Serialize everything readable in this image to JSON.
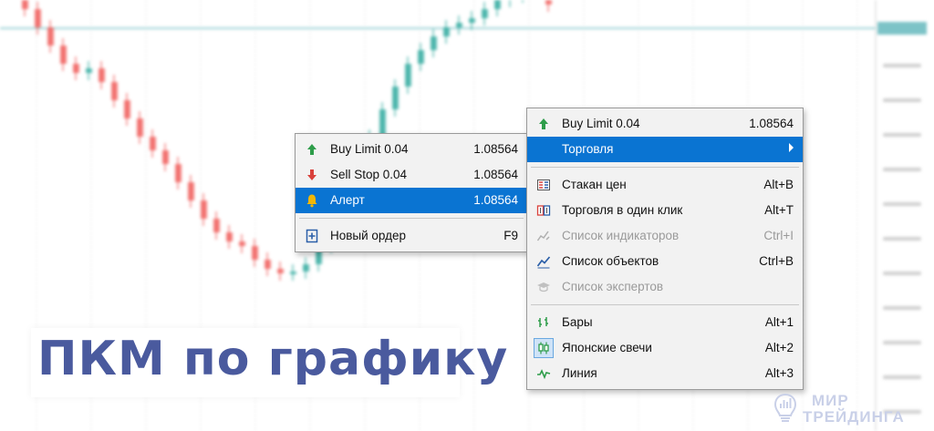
{
  "context_menu": {
    "items": [
      {
        "label": "Buy Limit 0.04",
        "right": "1.08564",
        "icon": "buy-limit-icon"
      },
      {
        "label": "Торговля",
        "right": "",
        "icon": "",
        "highlighted": true,
        "has_submenu": true
      },
      {
        "label": "Стакан цен",
        "right": "Alt+B",
        "icon": "depth-of-market-icon"
      },
      {
        "label": "Торговля в один клик",
        "right": "Alt+T",
        "icon": "one-click-trading-icon"
      },
      {
        "label": "Список индикаторов",
        "right": "Ctrl+I",
        "icon": "indicators-list-icon",
        "disabled": true
      },
      {
        "label": "Список объектов",
        "right": "Ctrl+B",
        "icon": "objects-list-icon"
      },
      {
        "label": "Список экспертов",
        "right": "",
        "icon": "experts-list-icon",
        "disabled": true
      },
      {
        "label": "Бары",
        "right": "Alt+1",
        "icon": "bars-icon"
      },
      {
        "label": "Японские свечи",
        "right": "Alt+2",
        "icon": "candlesticks-icon",
        "checked": true
      },
      {
        "label": "Линия",
        "right": "Alt+3",
        "icon": "line-chart-icon"
      }
    ]
  },
  "submenu": {
    "items": [
      {
        "label": "Buy Limit 0.04",
        "right": "1.08564",
        "icon": "buy-limit-icon"
      },
      {
        "label": "Sell Stop 0.04",
        "right": "1.08564",
        "icon": "sell-stop-icon"
      },
      {
        "label": "Алерт",
        "right": "1.08564",
        "icon": "alert-bell-icon",
        "highlighted": true
      },
      {
        "label": "Новый ордер",
        "right": "F9",
        "icon": "new-order-icon"
      }
    ]
  },
  "banner": {
    "text": "ПКМ по графику"
  },
  "logo": {
    "line1": "МИР",
    "line2": "ТРЕЙДИНГА"
  },
  "colors": {
    "bull": "#26a69a",
    "bear": "#ef5350",
    "highlight": "#0a74d2",
    "banner_text": "#4a5a9e"
  }
}
